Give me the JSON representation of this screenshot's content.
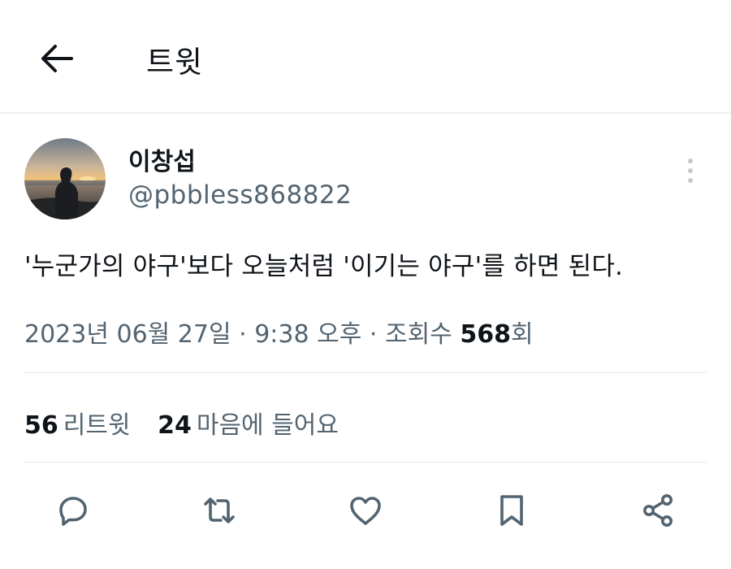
{
  "header": {
    "title": "트윗",
    "back_icon": "arrow-left-icon"
  },
  "author": {
    "name": "이창섭",
    "handle": "@pbbless868822",
    "avatar": "sunset-silhouette-avatar"
  },
  "tweet": {
    "text": "'누군가의 야구'보다 오늘처럼 '이기는 야구'를 하면 된다."
  },
  "meta": {
    "date": "2023년 06월 27일",
    "separator": "·",
    "time": "9:38 오후",
    "views_label": "조회수",
    "views_count": "568",
    "views_suffix": "회"
  },
  "stats": {
    "retweets_count": "56",
    "retweets_label": "리트윗",
    "likes_count": "24",
    "likes_label": "마음에 들어요"
  },
  "actions": [
    "reply-icon",
    "retweet-icon",
    "heart-icon",
    "bookmark-icon",
    "share-icon"
  ],
  "colors": {
    "text": "#0f1419",
    "secondary": "#536471",
    "divider": "#e3e7ea"
  }
}
